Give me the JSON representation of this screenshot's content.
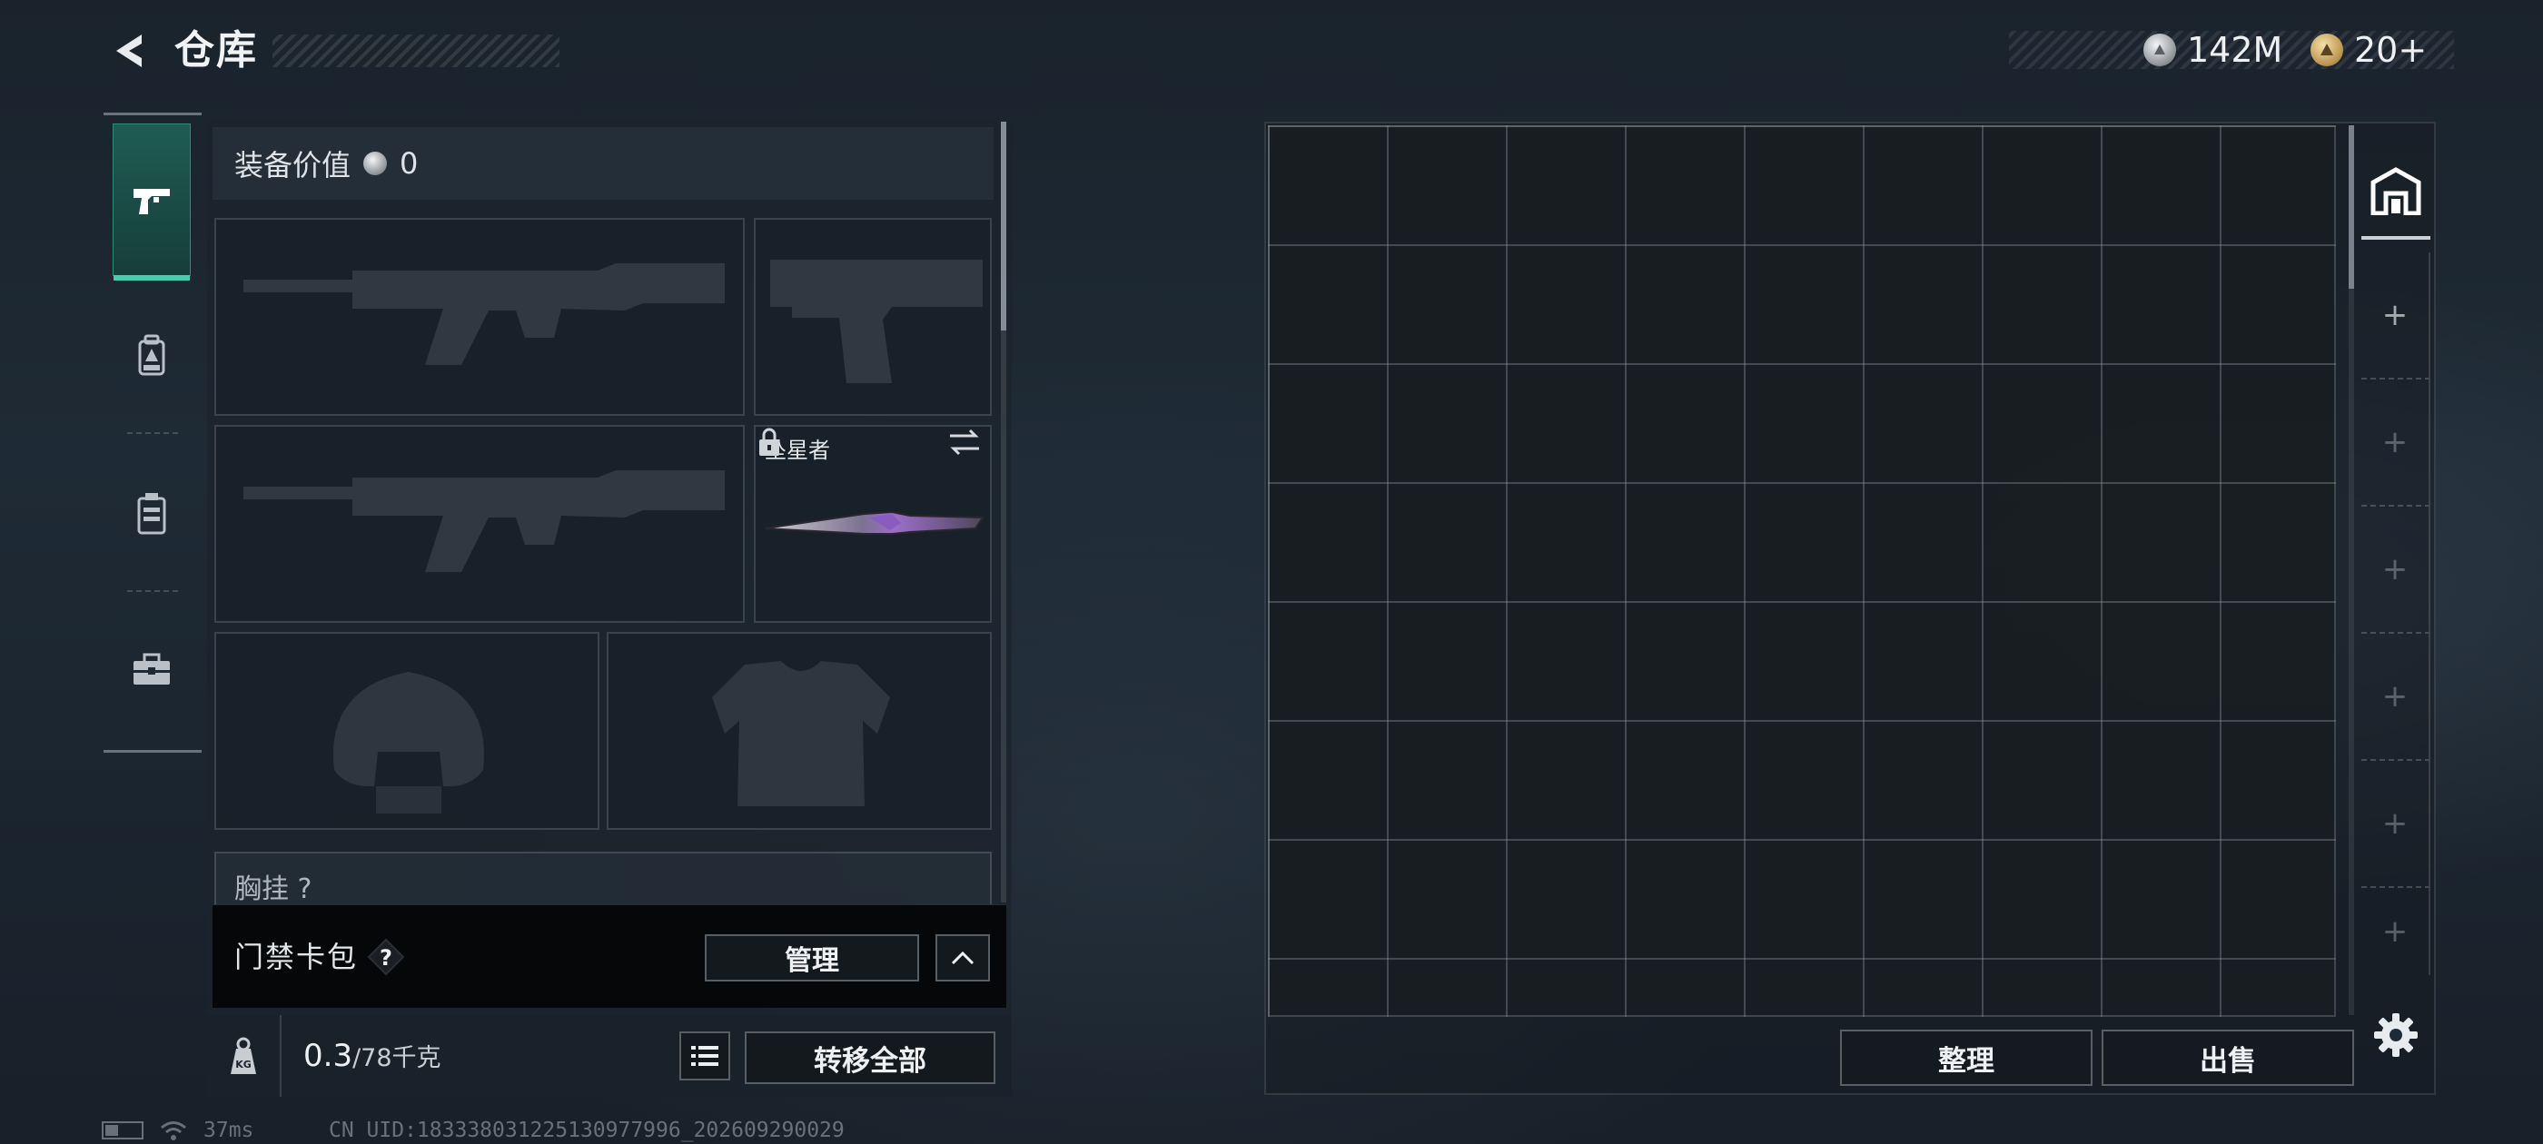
{
  "header": {
    "title": "仓库",
    "back_icon": "back-arrow-icon"
  },
  "currencies": [
    {
      "name": "silver-coin",
      "amount": "142M",
      "icon": "silver-coin-icon",
      "color": "#b8bcc0"
    },
    {
      "name": "gold-coin",
      "amount": "20+",
      "icon": "gold-coin-icon",
      "color": "#c9a45a"
    }
  ],
  "sidebar": {
    "tabs": [
      {
        "name": "weapons",
        "icon": "pistol-icon",
        "active": true
      },
      {
        "name": "backpack",
        "icon": "backpack-icon",
        "active": false
      },
      {
        "name": "vest",
        "icon": "vest-icon",
        "active": false
      },
      {
        "name": "toolbox",
        "icon": "toolbox-icon",
        "active": false
      }
    ]
  },
  "equipment": {
    "value_label": "装备价值",
    "value_amount": "0",
    "slots": {
      "primary_1": {
        "content": "empty",
        "silhouette": "rifle"
      },
      "pistol": {
        "content": "empty",
        "silhouette": "pistol"
      },
      "primary_2": {
        "content": "empty",
        "silhouette": "rifle"
      },
      "melee": {
        "content": "item",
        "item_name": "坠星者",
        "locked": true,
        "swappable": true
      },
      "helmet": {
        "content": "empty",
        "silhouette": "helmet"
      },
      "armor": {
        "content": "empty",
        "silhouette": "armor"
      }
    },
    "partial_slot_label": "胸挂 ?"
  },
  "keycard": {
    "label": "门禁卡包",
    "help": "?",
    "manage_label": "管理"
  },
  "weight": {
    "icon_label": "KG",
    "current": "0.3",
    "capacity": "/78千克",
    "transfer_label": "转移全部"
  },
  "storage": {
    "columns": 9,
    "visible_rows": 7.5,
    "sort_label": "整理",
    "sell_label": "出售",
    "pages": [
      {
        "icon": "storage-page-icon",
        "active": true
      },
      {
        "label": "+"
      },
      {
        "label": "+"
      },
      {
        "label": "+"
      },
      {
        "label": "+"
      },
      {
        "label": "+"
      },
      {
        "label": "+"
      }
    ]
  },
  "status": {
    "ping": "37ms",
    "uid": "CN UID:183338031225130977996_202609290029"
  },
  "colors": {
    "accent": "#3fd2b0",
    "active_tab_bg": "#1f5c53",
    "panel_bg": "#1c242d",
    "text": "#eef0f2"
  }
}
